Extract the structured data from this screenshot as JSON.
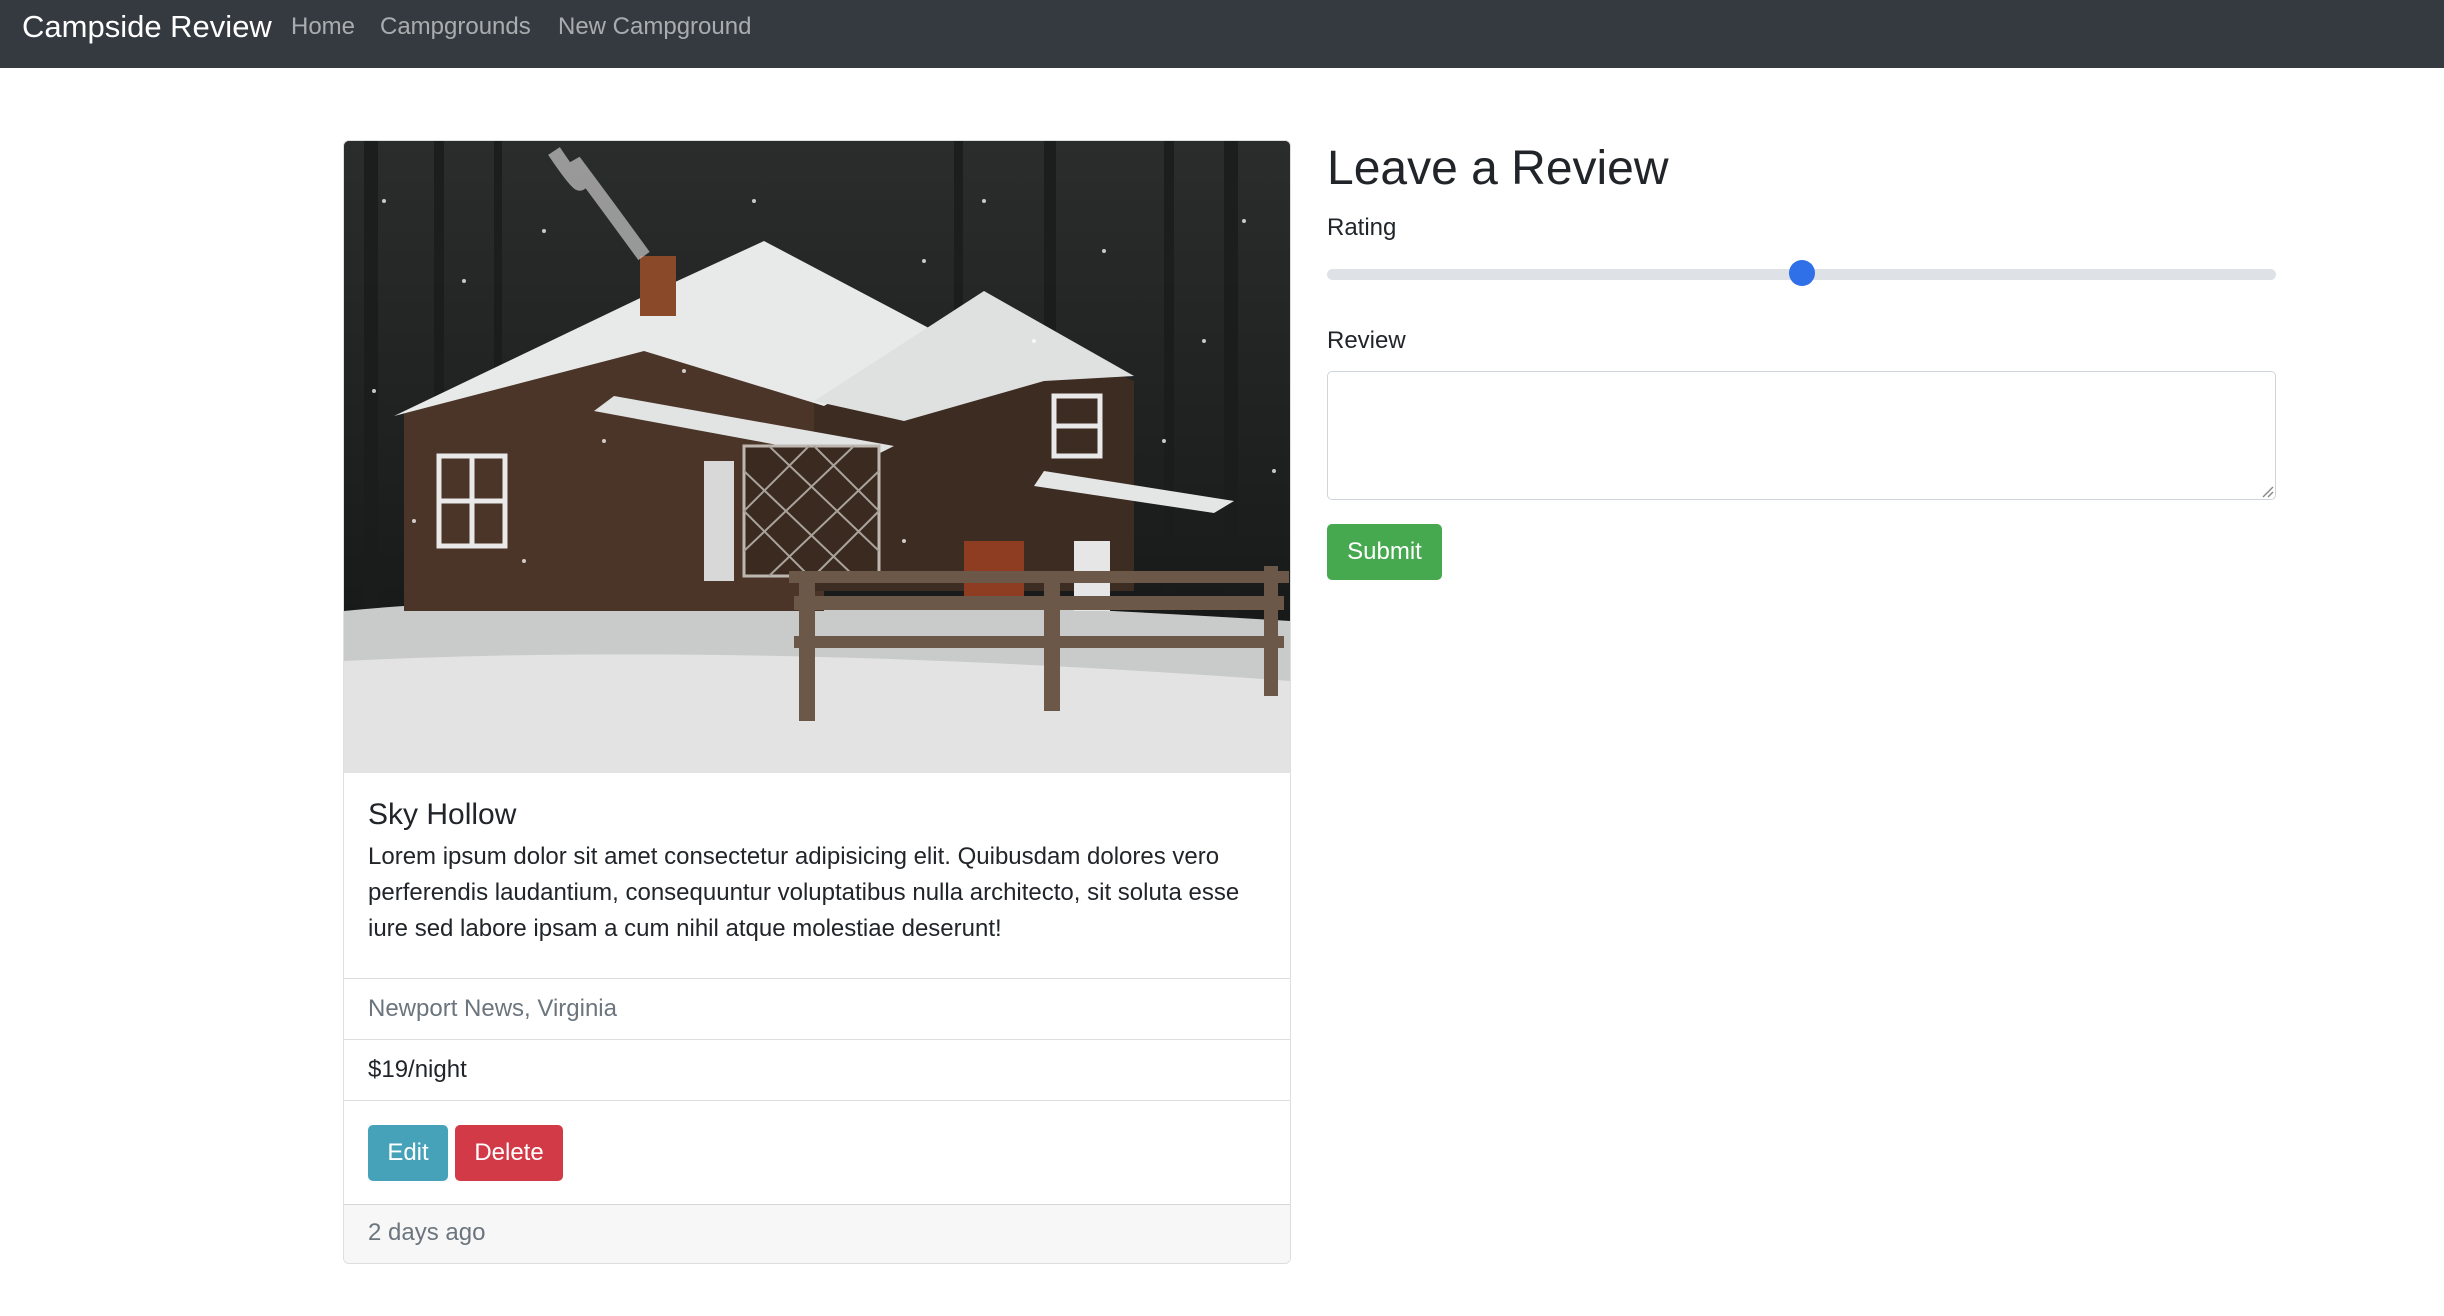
{
  "navbar": {
    "brand": "Campside Review",
    "links": [
      "Home",
      "Campgrounds",
      "New Campground"
    ]
  },
  "campground": {
    "title": "Sky Hollow",
    "description": "Lorem ipsum dolor sit amet consectetur adipisicing elit. Quibusdam dolores vero perferendis laudantium, consequuntur voluptatibus nulla architecto, sit soluta esse iure sed labore ipsam a cum nihil atque molestiae deserunt!",
    "location": "Newport News, Virginia",
    "price": "$19/night",
    "edit_label": "Edit",
    "delete_label": "Delete",
    "posted": "2 days ago",
    "image_alt": "snowy wooden cabin"
  },
  "review_form": {
    "heading": "Leave a Review",
    "rating_label": "Rating",
    "rating_value": 0.5,
    "review_label": "Review",
    "review_value": "",
    "submit_label": "Submit"
  },
  "colors": {
    "navbar_bg": "#343a40",
    "edit": "#46a2b8",
    "delete": "#d33a47",
    "submit": "#47a94f",
    "slider_thumb": "#2f6fe8"
  }
}
